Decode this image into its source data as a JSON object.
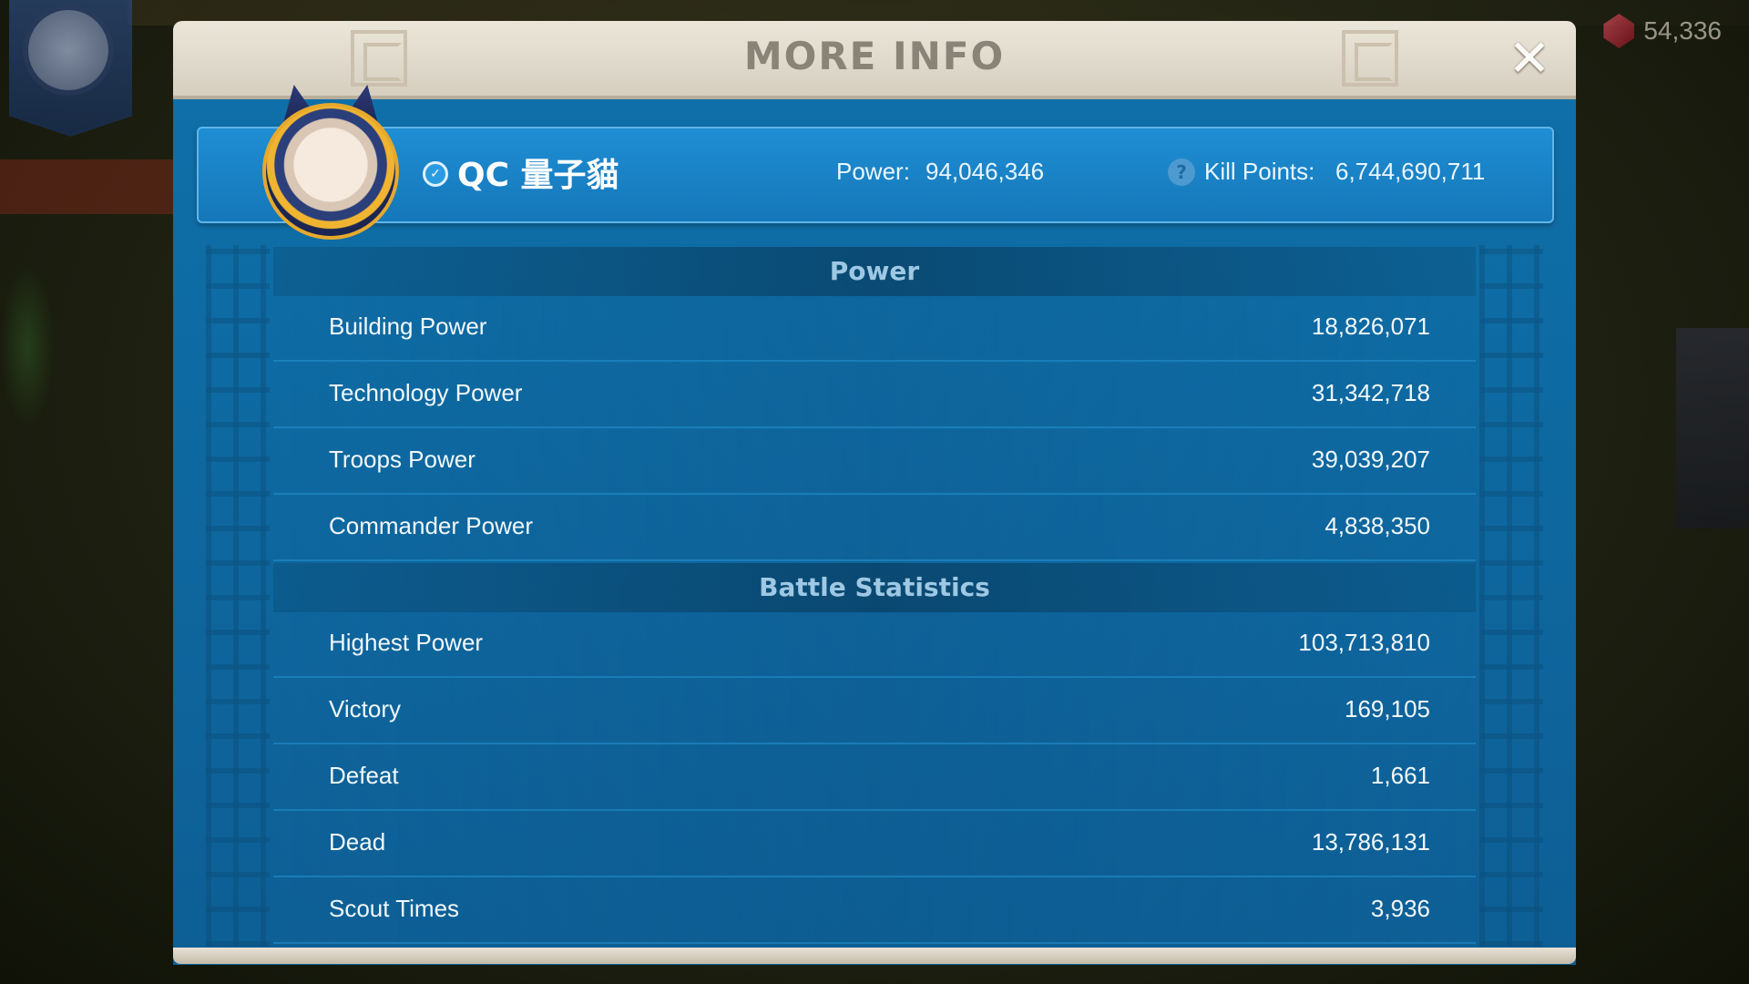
{
  "background": {
    "gems": "54,336"
  },
  "modal": {
    "title": "MORE INFO"
  },
  "player": {
    "name": "QC 量子貓",
    "power_label": "Power:",
    "power_value": "94,046,346",
    "kill_points_label": "Kill Points:",
    "kill_points_value": "6,744,690,711"
  },
  "sections": {
    "power": {
      "title": "Power",
      "rows": [
        {
          "label": "Building Power",
          "value": "18,826,071"
        },
        {
          "label": "Technology Power",
          "value": "31,342,718"
        },
        {
          "label": "Troops Power",
          "value": "39,039,207"
        },
        {
          "label": "Commander Power",
          "value": "4,838,350"
        }
      ]
    },
    "battle": {
      "title": "Battle Statistics",
      "rows": [
        {
          "label": "Highest Power",
          "value": "103,713,810"
        },
        {
          "label": "Victory",
          "value": "169,105"
        },
        {
          "label": "Defeat",
          "value": "1,661"
        },
        {
          "label": "Dead",
          "value": "13,786,131"
        },
        {
          "label": "Scout Times",
          "value": "3,936"
        }
      ]
    }
  },
  "icons": {
    "close": "close-icon",
    "verified": "verified-icon",
    "help": "help-icon",
    "gem": "gem-icon"
  },
  "colors": {
    "panel_blue": "#0f6fa8",
    "player_bar": "#1f8ed4",
    "header_cream": "#ece6da",
    "title_text": "#8a8378"
  }
}
